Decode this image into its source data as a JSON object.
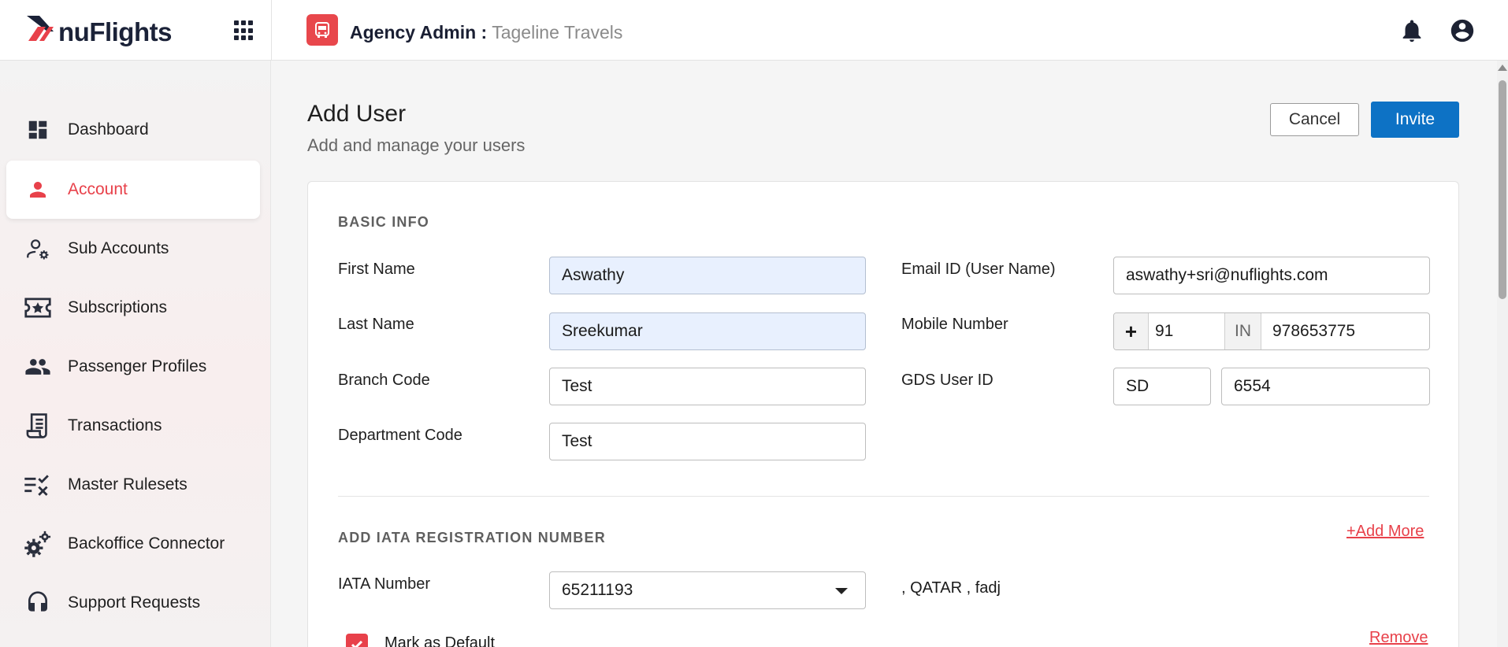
{
  "header": {
    "logo_text": "nuFlights",
    "agency_label": "Agency Admin :",
    "agency_name": "Tageline Travels"
  },
  "sidebar": {
    "items": [
      {
        "label": "Dashboard",
        "icon": "dashboard-icon"
      },
      {
        "label": "Account",
        "icon": "person-icon",
        "active": true
      },
      {
        "label": "Sub Accounts",
        "icon": "user-settings-icon"
      },
      {
        "label": "Subscriptions",
        "icon": "ticket-star-icon"
      },
      {
        "label": "Passenger Profiles",
        "icon": "people-icon"
      },
      {
        "label": "Transactions",
        "icon": "receipt-icon"
      },
      {
        "label": "Master Rulesets",
        "icon": "rules-check-icon"
      },
      {
        "label": "Backoffice Connector",
        "icon": "gears-icon"
      },
      {
        "label": "Support Requests",
        "icon": "headset-icon"
      }
    ]
  },
  "page": {
    "title": "Add User",
    "subtitle": "Add and manage your users",
    "cancel_label": "Cancel",
    "invite_label": "Invite"
  },
  "basic_info": {
    "heading": "BASIC INFO",
    "first_name_label": "First Name",
    "first_name_value": "Aswathy",
    "last_name_label": "Last Name",
    "last_name_value": "Sreekumar",
    "branch_code_label": "Branch Code",
    "branch_code_value": "Test",
    "department_code_label": "Department Code",
    "department_code_value": "Test",
    "email_label": "Email ID (User Name)",
    "email_value": "aswathy+sri@nuflights.com",
    "mobile_label": "Mobile Number",
    "mobile_plus": "+",
    "mobile_code": "91",
    "mobile_country": "IN",
    "mobile_number": "978653775",
    "gds_label": "GDS User ID",
    "gds_prefix": "SD",
    "gds_value": "6554"
  },
  "iata": {
    "heading": "ADD IATA REGISTRATION NUMBER",
    "add_more_label": "+Add More",
    "number_label": "IATA Number",
    "number_value": "65211193",
    "info_text": ", QATAR , fadj",
    "default_label": "Mark as Default",
    "default_checked": true,
    "remove_label": "Remove"
  },
  "colors": {
    "accent": "#e8414a",
    "primary": "#0d72c5"
  }
}
